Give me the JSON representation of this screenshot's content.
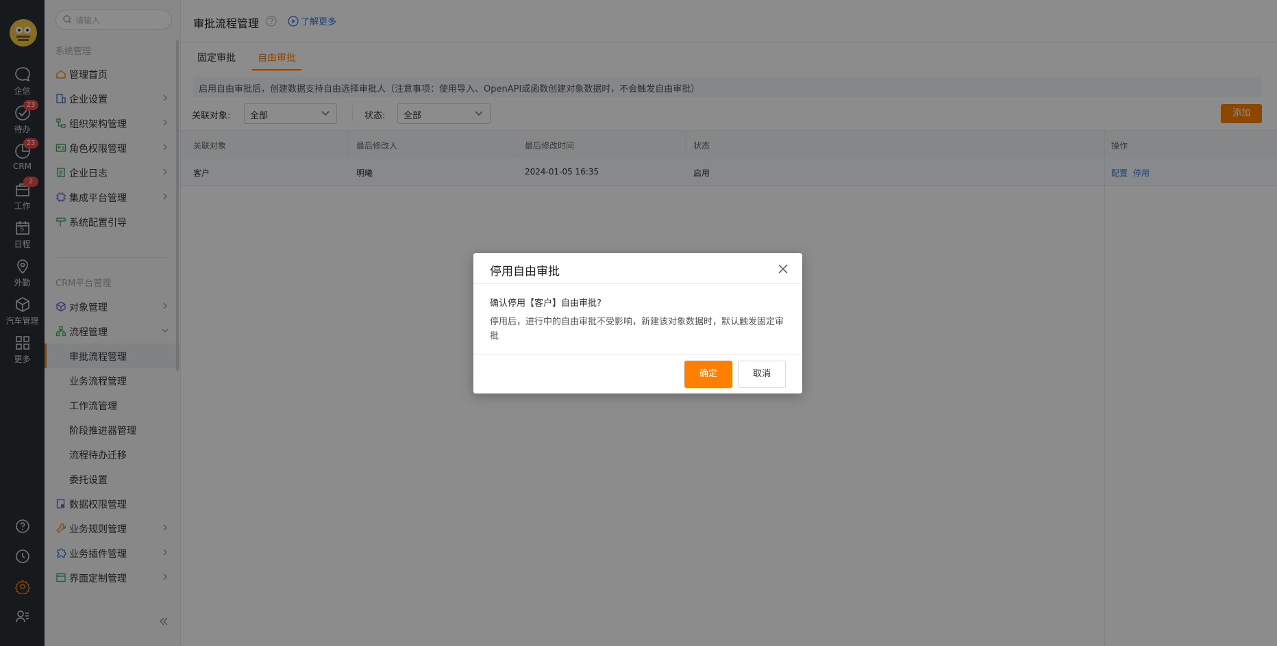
{
  "rail": {
    "items": [
      {
        "label": "企信",
        "badge": ""
      },
      {
        "label": "待办",
        "badge": "23"
      },
      {
        "label": "CRM",
        "badge": "23"
      },
      {
        "label": "工作",
        "badge": "2"
      },
      {
        "label": "日程",
        "badge": ""
      },
      {
        "label": "外勤",
        "badge": ""
      },
      {
        "label": "汽车管理",
        "badge": ""
      },
      {
        "label": "更多",
        "badge": ""
      }
    ],
    "calendar_day": "5",
    "bottom_icons": [
      "help-icon",
      "clock-icon",
      "settings-icon",
      "user-list-icon"
    ]
  },
  "nav": {
    "search_placeholder": "请输入",
    "section1": "系统管理",
    "items1": [
      {
        "label": "管理首页",
        "icon": "home-icon"
      },
      {
        "label": "企业设置",
        "icon": "building-icon"
      },
      {
        "label": "组织架构管理",
        "icon": "org-tree-icon"
      },
      {
        "label": "角色权限管理",
        "icon": "role-card-icon"
      },
      {
        "label": "企业日志",
        "icon": "log-icon"
      },
      {
        "label": "集成平台管理",
        "icon": "chip-icon"
      },
      {
        "label": "系统配置引导",
        "icon": "signpost-icon"
      }
    ],
    "section2": "CRM平台管理",
    "items2": [
      {
        "label": "对象管理",
        "icon": "cube-icon"
      },
      {
        "label": "流程管理",
        "icon": "flow-icon"
      }
    ],
    "sub_items": [
      "审批流程管理",
      "业务流程管理",
      "工作流管理",
      "阶段推进器管理",
      "流程待办迁移",
      "委托设置"
    ],
    "items3": [
      {
        "label": "数据权限管理",
        "icon": "data-lock-icon"
      },
      {
        "label": "业务规则管理",
        "icon": "wrench-icon"
      },
      {
        "label": "业务插件管理",
        "icon": "puzzle-icon"
      },
      {
        "label": "界面定制管理",
        "icon": "layout-icon"
      }
    ]
  },
  "main": {
    "title": "审批流程管理",
    "learn_more": "了解更多",
    "tabs": [
      "固定审批",
      "自由审批"
    ],
    "notice": "启用自由审批后，创建数据支持自由选择审批人（注意事项：使用导入、OpenAPI或函数创建对象数据时，不会触发自由审批）",
    "filter_object_label": "关联对象:",
    "filter_object_value": "全部",
    "filter_status_label": "状态:",
    "filter_status_value": "全部",
    "add_button": "添加",
    "table": {
      "headers": [
        "关联对象",
        "最后修改人",
        "最后修改时间",
        "状态",
        "操作"
      ],
      "rows": [
        {
          "object": "客户",
          "modifier": "明曦",
          "time": "2024-01-05 16:35",
          "status": "启用",
          "actions": [
            "配置",
            "停用"
          ]
        }
      ]
    }
  },
  "dialog": {
    "title": "停用自由审批",
    "question": "确认停用【客户】自由审批?",
    "description": "停用后，进行中的自由审批不受影响，新建该对象数据时，默认触发固定审批",
    "confirm": "确定",
    "cancel": "取消"
  },
  "colors": {
    "accent": "#ff8000",
    "link": "#2d78e0",
    "rail_bg": "#283036"
  }
}
